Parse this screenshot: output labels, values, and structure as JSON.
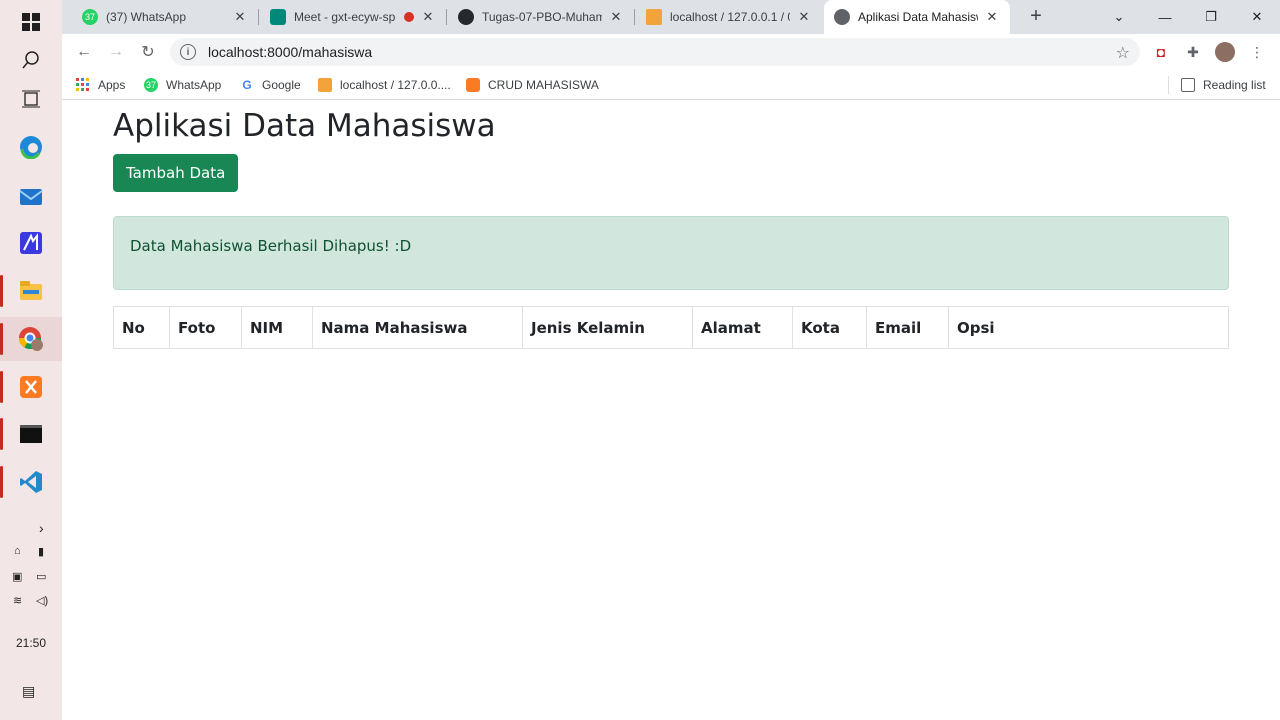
{
  "taskbar": {
    "items": [
      "windows-start",
      "search",
      "task-view",
      "edge",
      "mail",
      "app-blue",
      "file-explorer",
      "chrome",
      "xampp",
      "terminal",
      "vscode"
    ],
    "clock": "21:50"
  },
  "browser": {
    "tabs": [
      {
        "title": "(37) WhatsApp",
        "badge": "37"
      },
      {
        "title": "Meet - gxt-ecyw-sp"
      },
      {
        "title": "Tugas-07-PBO-Muham"
      },
      {
        "title": "localhost / 127.0.0.1 / 0"
      },
      {
        "title": "Aplikasi Data Mahasisw"
      }
    ],
    "url": "localhost:8000/mahasiswa",
    "bookmarks": [
      {
        "label": "Apps"
      },
      {
        "label": "WhatsApp",
        "badge": "37"
      },
      {
        "label": "Google"
      },
      {
        "label": "localhost / 127.0.0...."
      },
      {
        "label": "CRUD MAHASISWA"
      }
    ],
    "reading_list": "Reading list"
  },
  "page": {
    "title": "Aplikasi Data Mahasiswa",
    "add_button": "Tambah Data",
    "alert": "Data Mahasiswa Berhasil Dihapus! :D",
    "table_headers": [
      "No",
      "Foto",
      "NIM",
      "Nama Mahasiswa",
      "Jenis Kelamin",
      "Alamat",
      "Kota",
      "Email",
      "Opsi"
    ]
  },
  "colors": {
    "primary_button": "#198754",
    "alert_background": "#d1e7dd",
    "alert_text": "#0f5132"
  }
}
